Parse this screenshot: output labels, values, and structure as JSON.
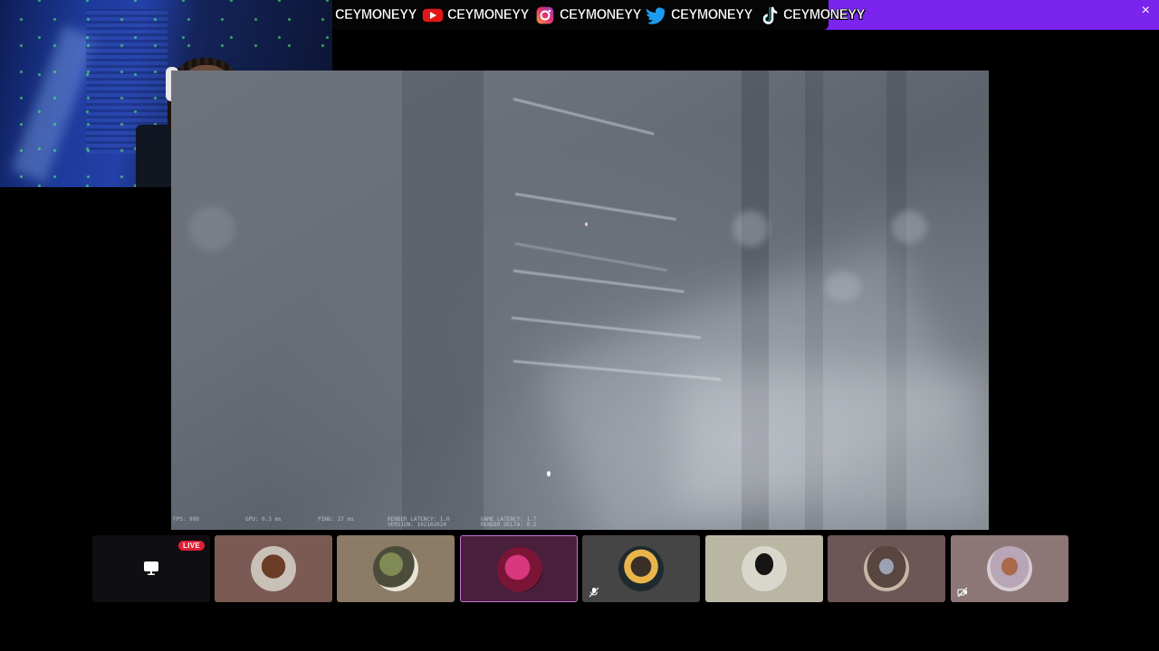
{
  "banner": {
    "handles": [
      "CEYMONEYY",
      "CEYMONEYY",
      "CEYMONEYY",
      "CEYMONEYY",
      "CEYMONEYY"
    ],
    "icons": [
      "youtube-icon",
      "instagram-icon",
      "twitter-icon",
      "tiktok-icon"
    ],
    "close_label": "×",
    "accent_color": "#7a24ee"
  },
  "webcam": {
    "subject": "streamer"
  },
  "game_hud": {
    "fps": "FPS: 999",
    "gpu": "GPU: 0.3 ms",
    "ping": "PING: 27 ms",
    "render_latency": "RENDER LATENCY: 1.0",
    "version": "VERSION: 102102024",
    "game_latency": "GAME LATENCY: 1.7",
    "render_delta": "RENDER DELTA: 0.2"
  },
  "strip": {
    "live_label": "LIVE",
    "tiles": [
      {
        "name": "screen-share",
        "bg": "#0f0f11",
        "active": false,
        "muted": false
      },
      {
        "name": "participant-1",
        "bg": "#7a5a52",
        "active": false,
        "muted": false
      },
      {
        "name": "participant-2",
        "bg": "#8c7b67",
        "active": false,
        "muted": false
      },
      {
        "name": "participant-3",
        "bg": "#4a1f3c",
        "active": true,
        "muted": false
      },
      {
        "name": "participant-4",
        "bg": "#454545",
        "active": false,
        "muted": true
      },
      {
        "name": "participant-5",
        "bg": "#b9b6a3",
        "active": false,
        "muted": false
      },
      {
        "name": "participant-6",
        "bg": "#6e5656",
        "active": false,
        "muted": false
      },
      {
        "name": "participant-7",
        "bg": "#8c7676",
        "active": false,
        "muted": true
      }
    ]
  }
}
